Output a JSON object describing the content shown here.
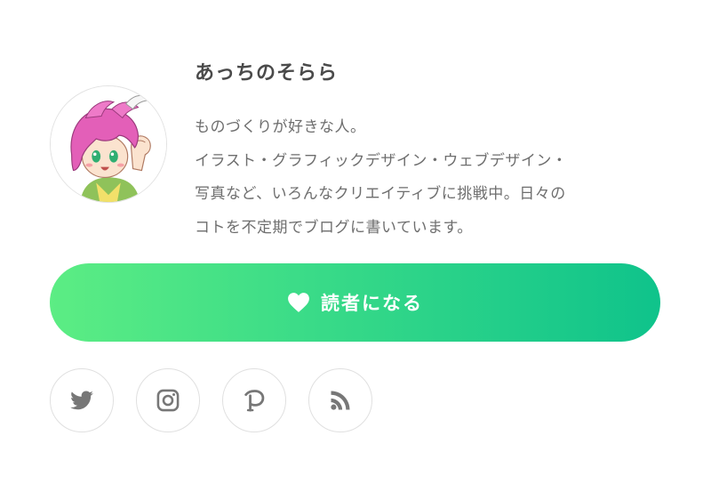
{
  "profile": {
    "name": "あっちのそらら",
    "bio_lines": [
      "ものづくりが好きな人。",
      "イラスト・グラフィックデザイン・ウェブデザイン・",
      "写真など、いろんなクリエイティブに挑戦中。日々の",
      "コトを不定期でブログに書いています。"
    ],
    "avatar_icon": "anime-avatar-pink-hair"
  },
  "subscribe_button": {
    "label": "読者になる",
    "icon": "heart-icon"
  },
  "social_links": [
    {
      "name": "twitter",
      "icon": "twitter-icon"
    },
    {
      "name": "instagram",
      "icon": "instagram-icon"
    },
    {
      "name": "pixiv",
      "icon": "pixiv-icon"
    },
    {
      "name": "rss",
      "icon": "rss-icon"
    }
  ],
  "colors": {
    "gradient_start": "#5ced84",
    "gradient_end": "#0fc38b",
    "icon_gray": "#777777",
    "text": "#6e6e6e",
    "name_text": "#4a4a4a"
  }
}
